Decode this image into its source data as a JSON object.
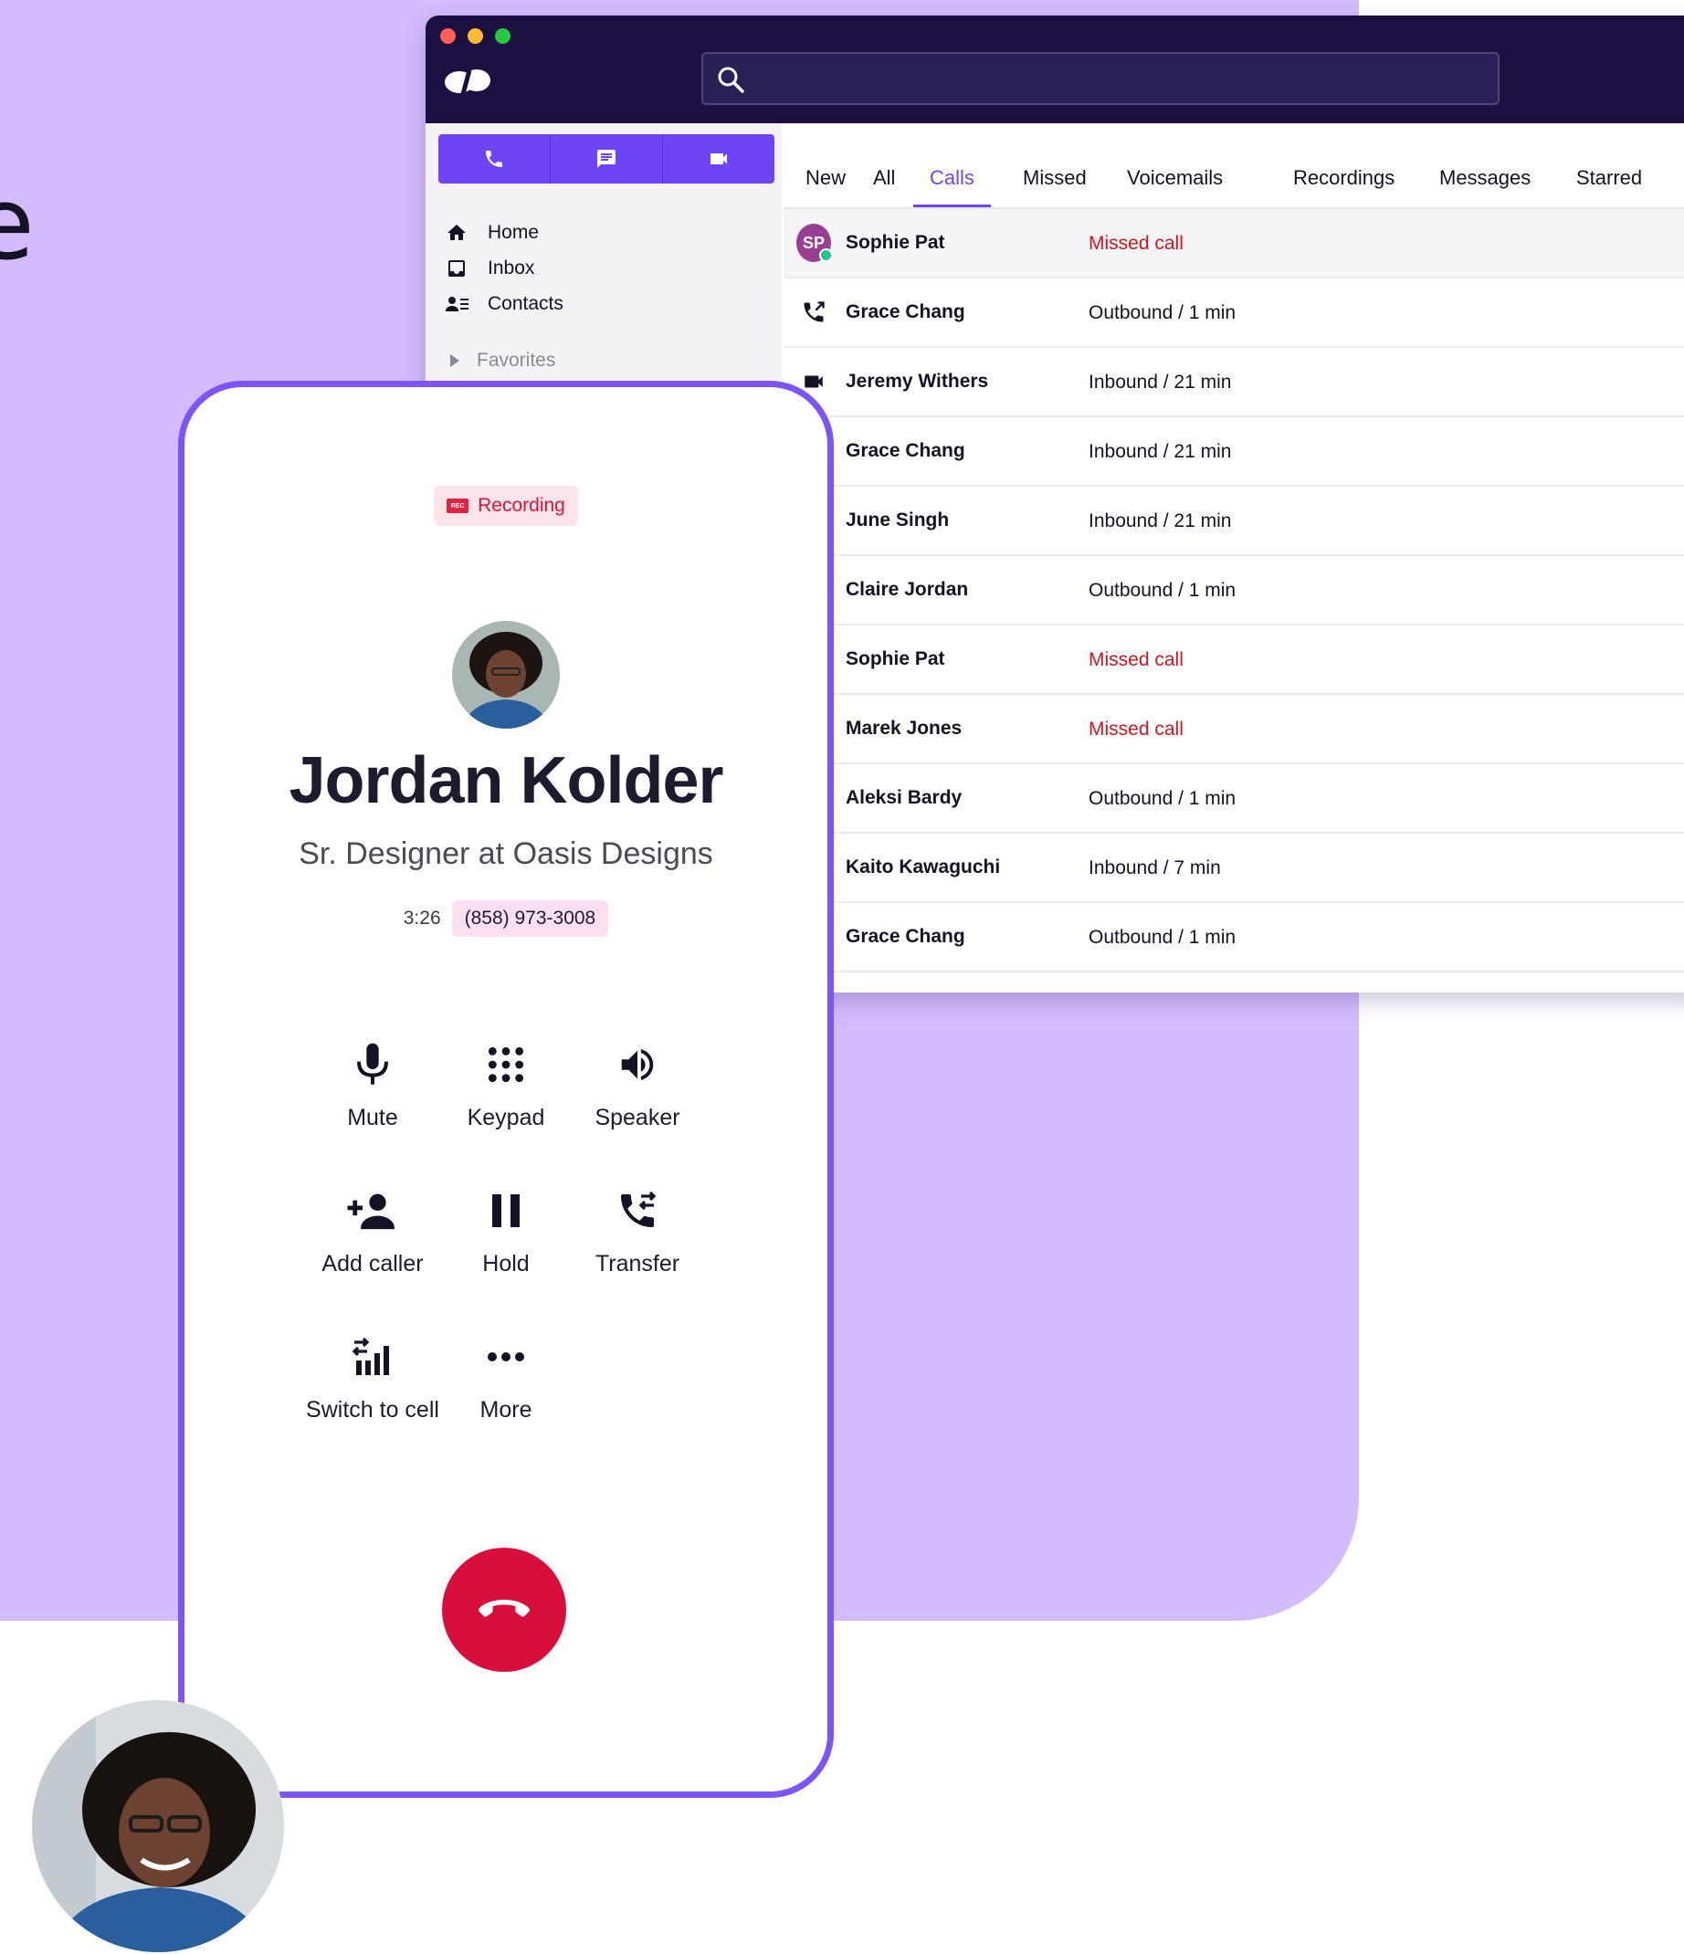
{
  "window": {
    "search_placeholder": "",
    "action_buttons": [
      {
        "icon": "phone-icon"
      },
      {
        "icon": "message-icon"
      },
      {
        "icon": "video-icon"
      }
    ],
    "nav": [
      {
        "label": "Home",
        "icon": "home-icon"
      },
      {
        "label": "Inbox",
        "icon": "inbox-icon"
      },
      {
        "label": "Contacts",
        "icon": "contacts-icon"
      }
    ],
    "favorites_label": "Favorites",
    "tabs": [
      "New",
      "All",
      "Calls",
      "Missed",
      "Voicemails",
      "Recordings",
      "Messages",
      "Starred"
    ],
    "active_tab": "Calls",
    "call_log": [
      {
        "name": "Sophie Pat",
        "status": "Missed call",
        "lead": "avatar",
        "initials": "SP",
        "missed": true
      },
      {
        "name": "Grace Chang",
        "status": "Outbound / 1 min",
        "lead": "outbound-call-icon",
        "missed": false
      },
      {
        "name": "Jeremy Withers",
        "status": "Inbound / 21 min",
        "lead": "video-icon",
        "missed": false
      },
      {
        "name": "Grace Chang",
        "status": "Inbound / 21 min",
        "lead": "",
        "missed": false
      },
      {
        "name": "June Singh",
        "status": "Inbound / 21 min",
        "lead": "",
        "missed": false
      },
      {
        "name": "Claire Jordan",
        "status": "Outbound / 1 min",
        "lead": "",
        "missed": false
      },
      {
        "name": "Sophie Pat",
        "status": "Missed call",
        "lead": "",
        "missed": true
      },
      {
        "name": "Marek Jones",
        "status": "Missed call",
        "lead": "",
        "missed": true
      },
      {
        "name": "Aleksi Bardy",
        "status": "Outbound / 1 min",
        "lead": "",
        "missed": false
      },
      {
        "name": "Kaito Kawaguchi",
        "status": "Inbound / 7 min",
        "lead": "",
        "missed": false
      },
      {
        "name": "Grace Chang",
        "status": "Outbound / 1 min",
        "lead": "",
        "missed": false
      }
    ]
  },
  "call": {
    "recording_badge": "Recording",
    "rec_icon_text": "REC",
    "caller_name": "Jordan Kolder",
    "caller_title": "Sr. Designer at Oasis Designs",
    "duration": "3:26",
    "phone_number": "(858) 973-3008",
    "controls": [
      {
        "label": "Mute",
        "icon": "microphone-icon"
      },
      {
        "label": "Keypad",
        "icon": "keypad-icon"
      },
      {
        "label": "Speaker",
        "icon": "speaker-icon"
      },
      {
        "label": "Add caller",
        "icon": "add-person-icon"
      },
      {
        "label": "Hold",
        "icon": "pause-icon"
      },
      {
        "label": "Transfer",
        "icon": "transfer-call-icon"
      },
      {
        "label": "Switch to cell",
        "icon": "switch-to-cell-icon"
      },
      {
        "label": "More",
        "icon": "more-icon"
      }
    ]
  },
  "colors": {
    "accent": "#6e45f4",
    "background_blob": "#d3bcfd",
    "titlebar": "#1b1040",
    "missed": "#d1141d",
    "hangup": "#d70f3a",
    "phone_border": "#7b55f5"
  }
}
